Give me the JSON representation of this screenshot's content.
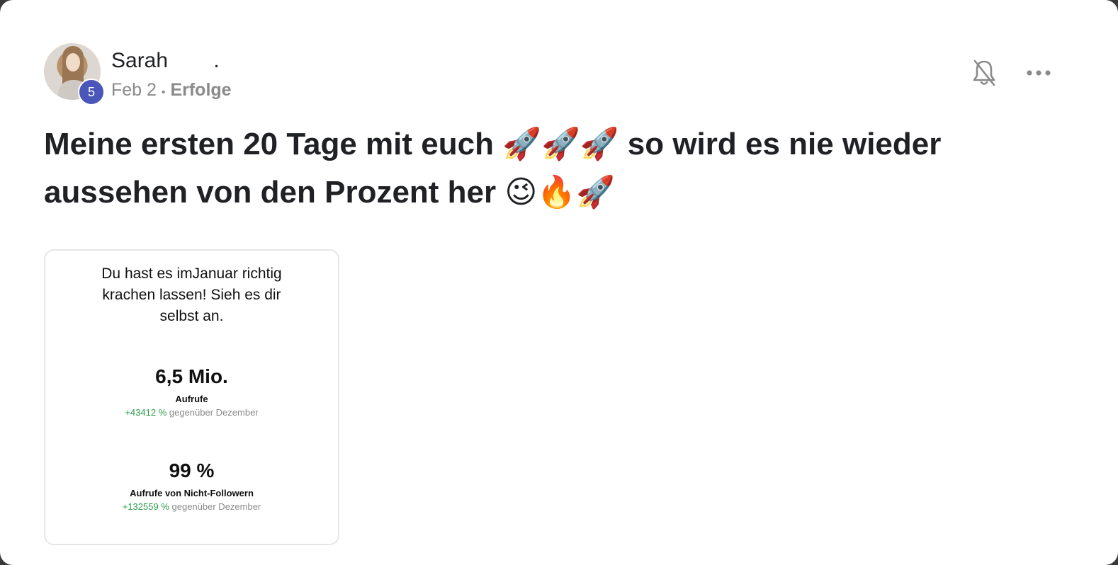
{
  "post": {
    "author": "Sarah",
    "author_suffix": ".",
    "level": "5",
    "date": "Feb 2",
    "separator": "•",
    "category": "Erfolge",
    "title": "Meine ersten 20 Tage mit euch 🚀🚀🚀 so wird es nie wieder aussehen von den Prozent her 😉🔥🚀"
  },
  "icons": {
    "bell": "bell-off-icon",
    "more": "more-horizontal-icon"
  },
  "attachment": {
    "heading": "Du hast es imJanuar richtig krachen lassen! Sieh es dir selbst an.",
    "stats": [
      {
        "value": "6,5 Mio.",
        "label": "Aufrufe",
        "change": "+43412 %",
        "compare": "gegenüber Dezember"
      },
      {
        "value": "99 %",
        "label": "Aufrufe von Nicht-Followern",
        "change": "+132559 %",
        "compare": "gegenüber Dezember"
      }
    ]
  },
  "colors": {
    "badge": "#4a56b8",
    "positive": "#2e9c4d",
    "text": "#202124",
    "muted": "#8a8a8a"
  }
}
